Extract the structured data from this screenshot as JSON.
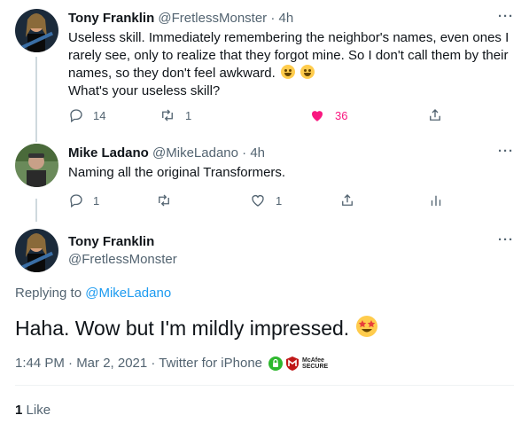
{
  "tweets": [
    {
      "name": "Tony Franklin",
      "handle": "@FretlessMonster",
      "time": "· 4h",
      "text_lines": [
        "Useless skill. Immediately remembering the neighbor's names, even ones I",
        "rarely see, only to realize that they forgot mine. So I don't call them by their",
        "names, so they don't feel awkward.",
        "What's your useless skill?"
      ],
      "reply_count": "14",
      "retweet_count": "1",
      "like_count": "36",
      "liked": true
    },
    {
      "name": "Mike Ladano",
      "handle": "@MikeLadano",
      "time": "· 4h",
      "text": "Naming all the original Transformers.",
      "reply_count": "1",
      "retweet_count": "",
      "like_count": "1"
    }
  ],
  "main_tweet": {
    "name": "Tony Franklin",
    "handle": "@FretlessMonster",
    "replying_label": "Replying to",
    "replying_to": "@MikeLadano",
    "text": "Haha. Wow but I'm mildly impressed.",
    "timestamp": "1:44 PM · Mar 2, 2021 · Twitter for iPhone",
    "like_count": "1",
    "like_label": "Like"
  },
  "more_label": "···",
  "badge_text": "McAfee\nSECURE",
  "colors": {
    "like_red": "#f91880",
    "mention_blue": "#1d9bf0",
    "muted": "#536471"
  },
  "icons": [
    "reply-icon",
    "retweet-icon",
    "heart-icon",
    "share-icon",
    "analytics-icon",
    "more-icon"
  ]
}
